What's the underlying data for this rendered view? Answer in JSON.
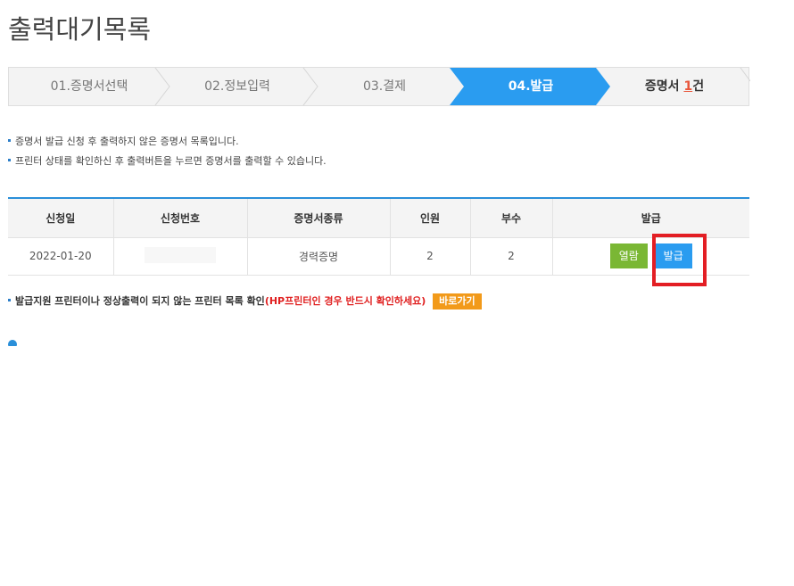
{
  "page": {
    "title": "출력대기목록"
  },
  "steps": [
    {
      "label": "01.증명서선택",
      "state": "inactive"
    },
    {
      "label": "02.정보입력",
      "state": "inactive"
    },
    {
      "label": "03.결제",
      "state": "inactive"
    },
    {
      "label": "04.발급",
      "state": "active"
    }
  ],
  "cert_count": {
    "prefix": "증명서 ",
    "number": "1",
    "suffix": "건"
  },
  "notes": [
    "증명서 발급 신청 후 출력하지 않은 증명서 목록입니다.",
    "프린터 상태를 확인하신 후 출력버튼을 누르면 증명서를 출력할 수 있습니다."
  ],
  "table": {
    "headers": [
      "신청일",
      "신청번호",
      "증명서종류",
      "인원",
      "부수",
      "발급"
    ],
    "rows": [
      {
        "date": "2022-01-20",
        "number": "",
        "type": "경력증명",
        "people": "2",
        "copies": "2"
      }
    ],
    "view_label": "열람",
    "issue_label": "발급"
  },
  "printer_note": {
    "text": "발급지원 프린터이나 정상출력이 되지 않는 프린터 목록 확인",
    "warning": "(HP프린터인 경우 반드시 확인하세요)",
    "goto_label": "바로가기"
  },
  "colors": {
    "active_step": "#2a9cf0",
    "table_top_border": "#2a8fd9",
    "view_button": "#7ab734",
    "issue_button": "#2a9cf0",
    "highlight": "#e31e24",
    "goto_button": "#f29a1a",
    "warning_text": "#e02020",
    "count_number": "#e8563b"
  }
}
